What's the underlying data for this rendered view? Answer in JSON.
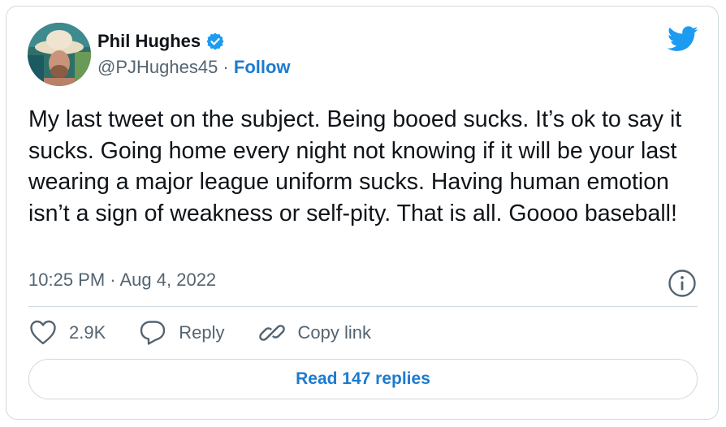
{
  "author": {
    "name": "Phil Hughes",
    "handle": "@PJHughes45",
    "separator": " · ",
    "follow_label": "Follow"
  },
  "tweet": {
    "text": "My last tweet on the subject. Being booed sucks. It’s ok to say it sucks. Going home every night not knowing if it will be your last wearing a major league uniform sucks. Having human emotion isn’t a sign of weakness or self-pity. That is all. Goooo baseball!",
    "timestamp": "10:25 PM · Aug 4, 2022"
  },
  "actions": {
    "likes_count": "2.9K",
    "reply_label": "Reply",
    "copy_link_label": "Copy link"
  },
  "footer": {
    "read_replies_label": "Read 147 replies"
  },
  "icons": {
    "brand": "twitter-bird-icon",
    "verified": "verified-badge-icon",
    "info": "info-icon",
    "like": "heart-icon",
    "reply": "reply-bubble-icon",
    "copy": "link-icon"
  },
  "colors": {
    "accent": "#1d9bf0",
    "link": "#1d7bcf",
    "text": "#0f1419",
    "secondary": "#536471",
    "border": "#cfd9de"
  }
}
